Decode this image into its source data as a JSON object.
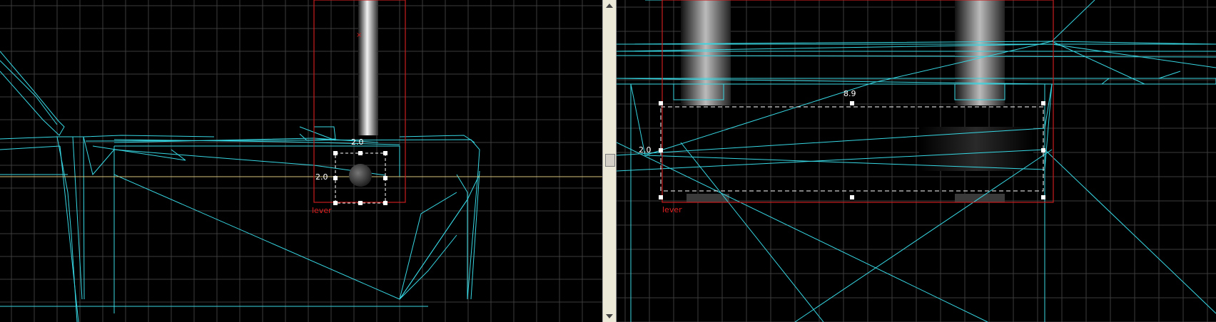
{
  "left_view": {
    "width_label": "2.0",
    "height_label": "2.0",
    "entity_label": "lever"
  },
  "right_view": {
    "width_label": "8.9",
    "height_label": "2.0",
    "entity_label": "lever"
  },
  "colors": {
    "background": "#000000",
    "grid": "#3c3c3c",
    "wireframe": "#37d7e3",
    "entity_box": "#c81e1e",
    "selection": "#ffffff",
    "axis_line": "#d9c37a"
  }
}
